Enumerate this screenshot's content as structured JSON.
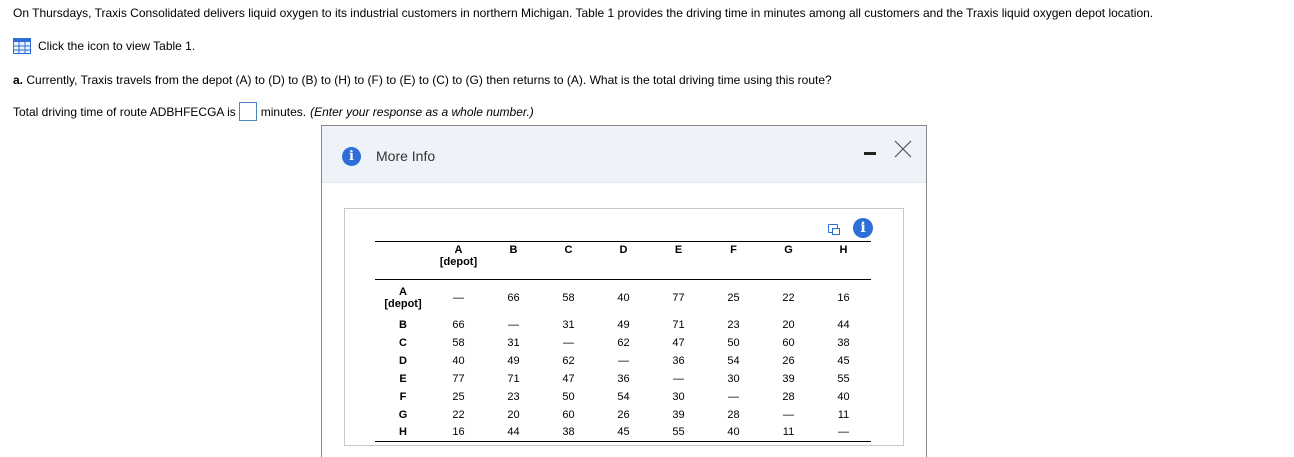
{
  "intro": "On Thursdays, Traxis Consolidated delivers liquid oxygen to its industrial customers in northern Michigan. Table 1 provides the driving time in minutes among all customers and the Traxis liquid oxygen depot location.",
  "table_link": {
    "icon": "table-icon",
    "text": "Click the icon to view Table 1."
  },
  "question": {
    "prefix": "a.",
    "text": " Currently, Traxis travels from the depot (A) to (D) to (B) to (H) to (F) to (E) to (C) to (G) then returns to (A). What is the total driving time using this route?"
  },
  "answer": {
    "label": "Total driving time of route ADBHFECGA is",
    "value": "",
    "suffix": "minutes.",
    "note": "(Enter your response as a whole number.)"
  },
  "dialog": {
    "title": "More Info",
    "accent": "#2d6fd6",
    "table": {
      "headers": [
        "A\n[depot]",
        "B",
        "C",
        "D",
        "E",
        "F",
        "G",
        "H"
      ],
      "rows": [
        {
          "label": "A\n[depot]",
          "cells": [
            "—",
            "66",
            "58",
            "40",
            "77",
            "25",
            "22",
            "16"
          ]
        },
        {
          "label": "B",
          "cells": [
            "66",
            "—",
            "31",
            "49",
            "71",
            "23",
            "20",
            "44"
          ]
        },
        {
          "label": "C",
          "cells": [
            "58",
            "31",
            "—",
            "62",
            "47",
            "50",
            "60",
            "38"
          ]
        },
        {
          "label": "D",
          "cells": [
            "40",
            "49",
            "62",
            "—",
            "36",
            "54",
            "26",
            "45"
          ]
        },
        {
          "label": "E",
          "cells": [
            "77",
            "71",
            "47",
            "36",
            "—",
            "30",
            "39",
            "55"
          ]
        },
        {
          "label": "F",
          "cells": [
            "25",
            "23",
            "50",
            "54",
            "30",
            "—",
            "28",
            "40"
          ]
        },
        {
          "label": "G",
          "cells": [
            "22",
            "20",
            "60",
            "26",
            "39",
            "28",
            "—",
            "11"
          ]
        },
        {
          "label": "H",
          "cells": [
            "16",
            "44",
            "38",
            "45",
            "55",
            "40",
            "11",
            "—"
          ]
        }
      ]
    }
  }
}
